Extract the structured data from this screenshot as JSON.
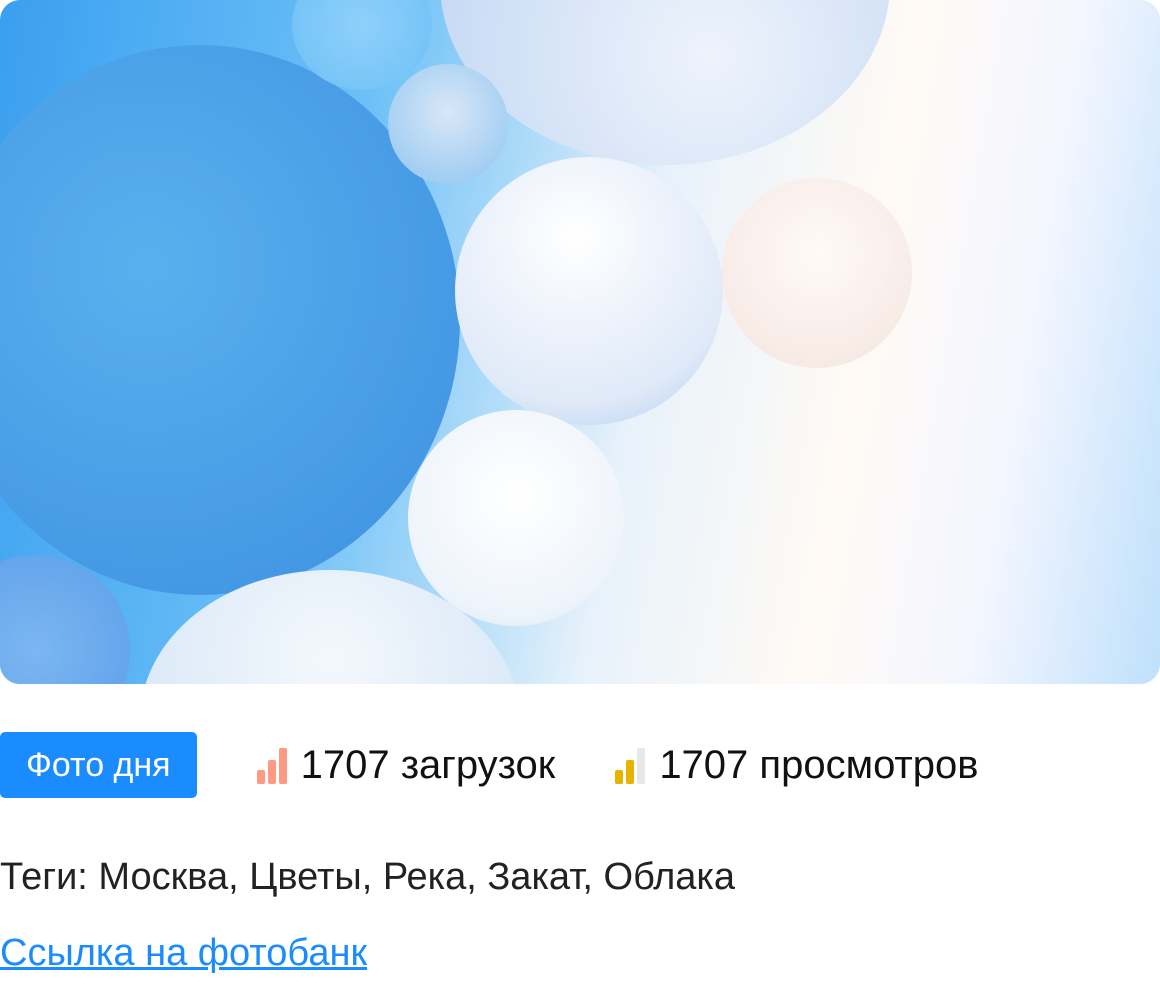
{
  "photo": {
    "alt": "Фото дня"
  },
  "badge": "Фото дня",
  "stats": {
    "downloads": {
      "text": "1707 загрузок",
      "icon": "bar-level-icon",
      "color": "#ff9a82",
      "level": 3
    },
    "views": {
      "text": "1707 просмотров",
      "icon": "bar-level-icon",
      "color": "#e6b400",
      "level": 2
    }
  },
  "tags": "Теги: Москва, Цветы, Река, Закат, Облака",
  "link": "Ссылка на фотобанк"
}
